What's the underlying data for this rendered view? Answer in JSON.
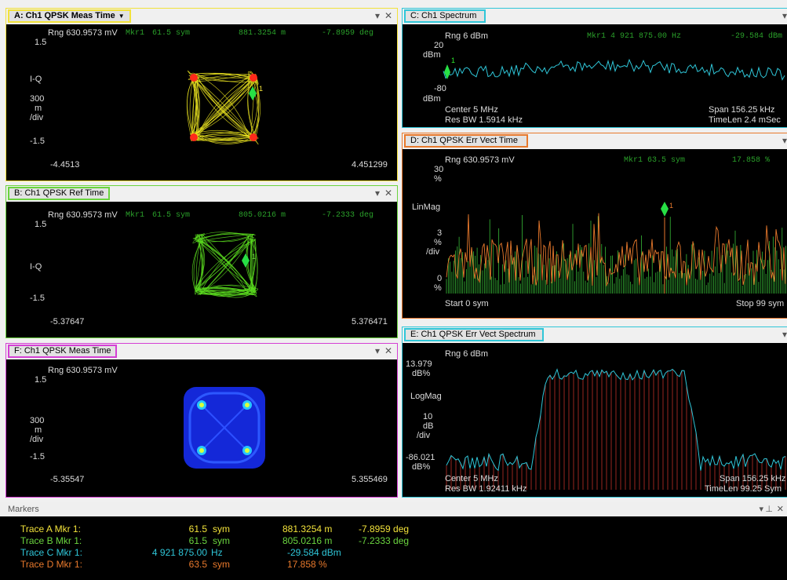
{
  "panels": {
    "a": {
      "title": "A: Ch1 QPSK Meas Time",
      "caret": "▼",
      "rng": "Rng 630.9573 mV",
      "mkr_label": "Mkr1",
      "mkr_x": "61.5 sym",
      "mkr_v1": "881.3254 m",
      "mkr_v2": "-7.8959 deg",
      "y_top": "1.5",
      "y_mid": "I-Q",
      "y_div": "300",
      "y_div2": "m",
      "y_div3": "/div",
      "y_bot": "-1.5",
      "x_left": "-4.4513",
      "x_right": "4.451299",
      "marker_num": "1",
      "trace_color": "#e8e020",
      "accent": "#f2e23a"
    },
    "b": {
      "title": "B: Ch1 QPSK Ref Time",
      "rng": "Rng 630.9573 mV",
      "mkr_label": "Mkr1",
      "mkr_x": "61.5 sym",
      "mkr_v1": "805.0216 m",
      "mkr_v2": "-7.2333 deg",
      "y_top": "1.5",
      "y_mid": "I-Q",
      "y_bot": "-1.5",
      "x_left": "-5.37647",
      "x_right": "5.376471",
      "marker_num": "1",
      "trace_color": "#5adc1e",
      "accent": "#6bd43f"
    },
    "f": {
      "title": "F: Ch1 QPSK Meas Time",
      "rng": "Rng 630.9573 mV",
      "y_top": "1.5",
      "y_div": "300",
      "y_div2": "m",
      "y_div3": "/div",
      "y_bot": "-1.5",
      "x_left": "-5.35547",
      "x_right": "5.355469",
      "accent": "#d43fd4"
    },
    "c": {
      "title": "C: Ch1 Spectrum",
      "rng": "Rng 6 dBm",
      "mkr": "Mkr1  4 921 875.00 Hz",
      "mkr_val": "-29.584 dBm",
      "y_top": "20",
      "y_top_unit": "dBm",
      "y_bot": "-80",
      "y_bot_unit": "dBm",
      "center": "Center 5 MHz",
      "span": "Span 156.25 kHz",
      "res_bw": "Res BW 1.5914 kHz",
      "timelen": "TimeLen 2.4 mSec",
      "marker_num": "1",
      "accent": "#2fc6d8"
    },
    "d": {
      "title": "D: Ch1 QPSK Err Vect Time",
      "rng": "Rng 630.9573 mV",
      "mkr": "Mkr1  63.5 sym",
      "mkr_val": "17.858  %",
      "y_top": "30",
      "y_top_unit": "%",
      "scale": "LinMag",
      "y_div": "3",
      "y_div2": "%",
      "y_div3": "/div",
      "y_bot": "0",
      "y_bot_unit": "%",
      "start": "Start 0  sym",
      "stop": "Stop 99  sym",
      "marker_num": "1",
      "accent": "#e8792c"
    },
    "e": {
      "title": "E: Ch1 QPSK Err Vect Spectrum",
      "rng": "Rng 6 dBm",
      "y_top": "13.979",
      "y_top_unit": "dB%",
      "scale": "LogMag",
      "y_div": "10",
      "y_div2": "dB",
      "y_div3": "/div",
      "y_bot": "-86.021",
      "y_bot_unit": "dB%",
      "center": "Center 5 MHz",
      "span": "Span 156.25 kHz",
      "res_bw": "Res BW 1.92411 kHz",
      "timelen": "TimeLen 99.25  Sym",
      "accent": "#2fc6d8"
    }
  },
  "controls": {
    "dropdown": "▾",
    "close": "✕",
    "pin": "⊥"
  },
  "markers": {
    "title": "Markers",
    "rows": [
      {
        "trace": "Trace  A  Mkr  1:",
        "x": "61.5",
        "xunit": "sym",
        "v1": "881.3254 m",
        "v2": "-7.8959  deg",
        "color": "#f2e23a"
      },
      {
        "trace": "Trace  B  Mkr  1:",
        "x": "61.5",
        "xunit": "sym",
        "v1": "805.0216 m",
        "v2": "-7.2333  deg",
        "color": "#6bd43f"
      },
      {
        "trace": "Trace  C  Mkr  1:",
        "x": "4 921 875.00",
        "xunit": "Hz",
        "v1": "-29.584 dBm",
        "v2": "",
        "color": "#2fc6d8"
      },
      {
        "trace": "Trace  D  Mkr  1:",
        "x": "63.5",
        "xunit": "sym",
        "v1": "17.858  %",
        "v2": "",
        "color": "#e8792c"
      }
    ]
  }
}
